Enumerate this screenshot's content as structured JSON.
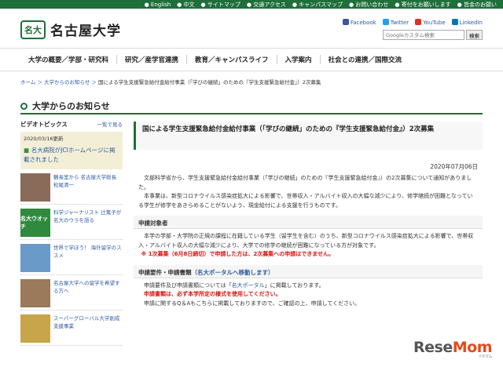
{
  "topbar": [
    "● English",
    "● 中文",
    "● サイトマップ",
    "● 交通アクセス",
    "● キャンパスマップ",
    "● お問い合わせ",
    "● 寄付をお願いします",
    "● 皆金のお願い"
  ],
  "logo": {
    "mark": "名大",
    "text": "名古屋大学"
  },
  "social": {
    "facebook": "Facebook",
    "twitter": "Twitter",
    "youtube": "YouTube",
    "linkedin": "LinkedIn"
  },
  "search": {
    "placeholder": "Googleカスタム検索",
    "button": "検索"
  },
  "nav": [
    "大学の概要／学部・研究科",
    "研究／産学官連携",
    "教育／キャンパスライフ",
    "入学案内",
    "社会との連携／国際交流"
  ],
  "breadcrumb": {
    "home": "ホーム",
    "sep": " ＞ ",
    "news": "大学からのお知らせ",
    "current": "国による学生支援緊急給付金給付事業（「学びの継続」のための『学生支援緊急給付金』）2次募集"
  },
  "section_title": "大学からのお知らせ",
  "sidebar": {
    "video_title": "ビデオトピックス",
    "more": "一覧で見る",
    "date": "2020/03/16更新",
    "news": "名大病院がJCIホームページに掲載されました",
    "cards": [
      {
        "text": "鶴長室から 名古屋大学総長 松尾清一",
        "thumb": "",
        "color": "#8a6b5a"
      },
      {
        "text": "科学ジャーナリスト 辻篤子が名大のウラを語る",
        "thumb": "名大ウオッチ",
        "color": "#2f8a3e"
      },
      {
        "text": "世界で学ぼう！ 海外留学のススメ",
        "thumb": "",
        "color": "#6a9ac8"
      },
      {
        "text": "名古屋大学への留学を希望する方へ",
        "thumb": "",
        "color": "#9a7a5a"
      },
      {
        "text": "スーパーグローバル大学創成支援事業",
        "thumb": "",
        "color": "#c8a44a"
      }
    ]
  },
  "article": {
    "title": "国による学生支援緊急給付金給付事業（「学びの継続」のための『学生支援緊急給付金』）2次募集",
    "date": "2020年07月06日",
    "p1": "文部科学省から、学生支援緊急給付金給付事業（「学びの継続」のための『学生支援緊急給付金』）の2次募集について通知がありました。",
    "p2": "本事業は、新型コロナウイルス感染症拡大による影響で、世帯収入・アルバイト収入の大幅な減少により、修学継続が困難となっている学生が修学をあきらめることがないよう、現金給付による支援を行うものです。",
    "h1": "申請対象者",
    "p3": "本学の学部・大学院の正規の課程に在籍している学生（留学生を含む）のうち、新型コロナウイルス感染症拡大による影響で、世帯収入・アルバイト収入の大幅な減少により、大学での修学の継続が困難になっている方が対象です。",
    "warn1": "※ 1次募集（6月8日締切）で申請した方は、2次募集への申請はできません。",
    "h2": "申請要件・申請書類",
    "h2_link": "（名大ポータルへ移動します）",
    "p4a": "申請要件及び申請書類については「",
    "p4link": "名大ポータル",
    "p4b": "」に掲載しております。",
    "warn2": "申請書類は、必ず本学所定の様式を使用してください。",
    "p5": "申請に関するQ＆Aもこちらに掲載しておりますので、ご確認の上、申請してください。"
  },
  "watermark": {
    "a": "Rese",
    "b": "Mom",
    "small": "リセマム"
  }
}
